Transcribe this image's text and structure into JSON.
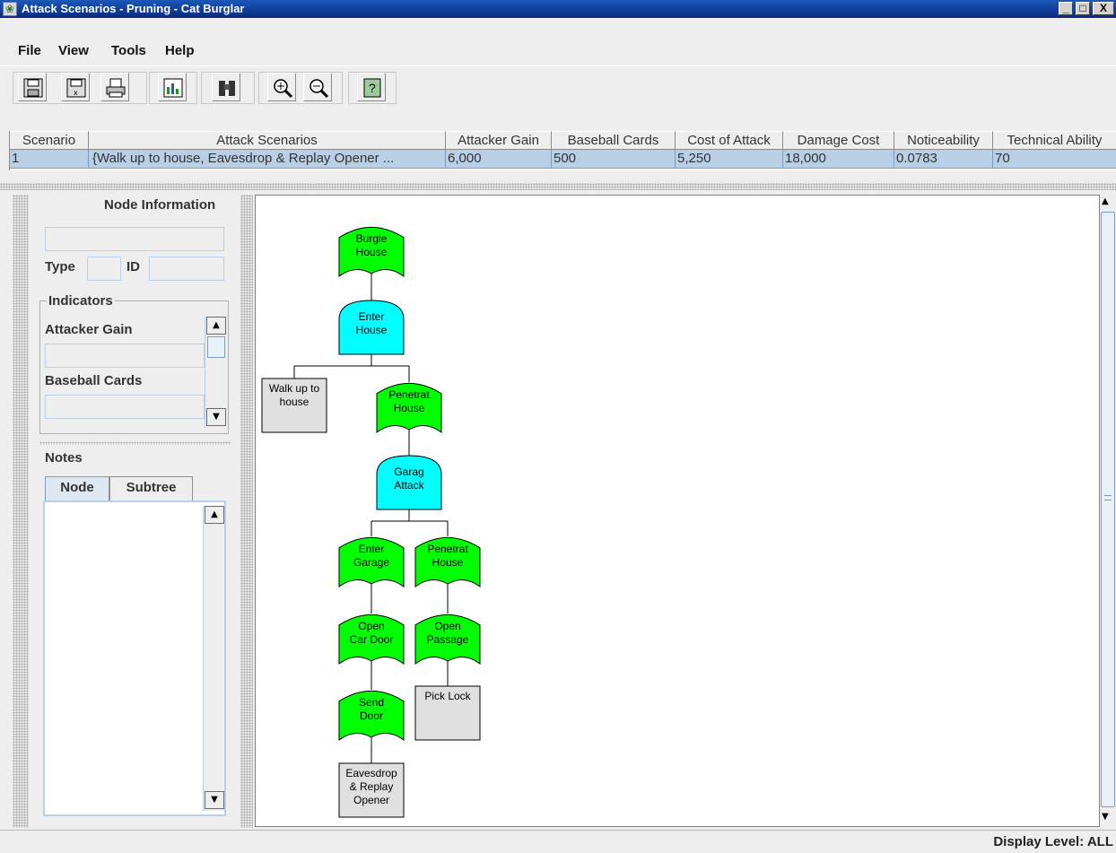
{
  "window": {
    "title": "Attack Scenarios - Pruning - Cat Burglar",
    "controls": [
      "_",
      "□",
      "X"
    ]
  },
  "menu": [
    "File",
    "View",
    "Tools",
    "Help"
  ],
  "toolbar": [
    "save-icon",
    "save-as-icon",
    "print-icon",
    "chart-icon",
    "binoculars-icon",
    "zoom-in-icon",
    "zoom-out-icon",
    "help-icon"
  ],
  "table": {
    "columns": [
      "Scenario",
      "Attack Scenarios",
      "Attacker Gain",
      "Baseball Cards",
      "Cost of Attack",
      "Damage Cost",
      "Noticeability",
      "Technical Ability"
    ],
    "rows": [
      [
        "1",
        "{Walk up to house, Eavesdrop & Replay Opener ...",
        "6,000",
        "500",
        "5,250",
        "18,000",
        "0.0783",
        "70"
      ]
    ]
  },
  "left_panel": {
    "node_information": "Node Information",
    "type_label": "Type",
    "id_label": "ID",
    "indicators_title": "Indicators",
    "attacker_gain": "Attacker Gain",
    "baseball_cards": "Baseball Cards",
    "notes_title": "Notes",
    "tabs": [
      "Node",
      "Subtree"
    ]
  },
  "tree": {
    "colors": {
      "or_node": "#00ff00",
      "and_node": "#00ffff",
      "leaf": "#e0e0e0"
    },
    "nodes": [
      [
        "Burgle",
        "House"
      ],
      [
        "Enter",
        "House"
      ],
      [
        "Walk up to",
        "house"
      ],
      [
        "Penetrat",
        "House"
      ],
      [
        "Garag",
        "Attack"
      ],
      [
        "Enter",
        "Garage"
      ],
      [
        "Penetrat",
        "House"
      ],
      [
        "Open",
        "Car Door"
      ],
      [
        "Open",
        "Passage"
      ],
      [
        "Pick Lock"
      ],
      [
        "Send",
        "Door"
      ],
      [
        "Eavesdrop",
        "& Replay",
        "Opener"
      ]
    ]
  },
  "status": {
    "display_level": "Display Level: ALL"
  }
}
